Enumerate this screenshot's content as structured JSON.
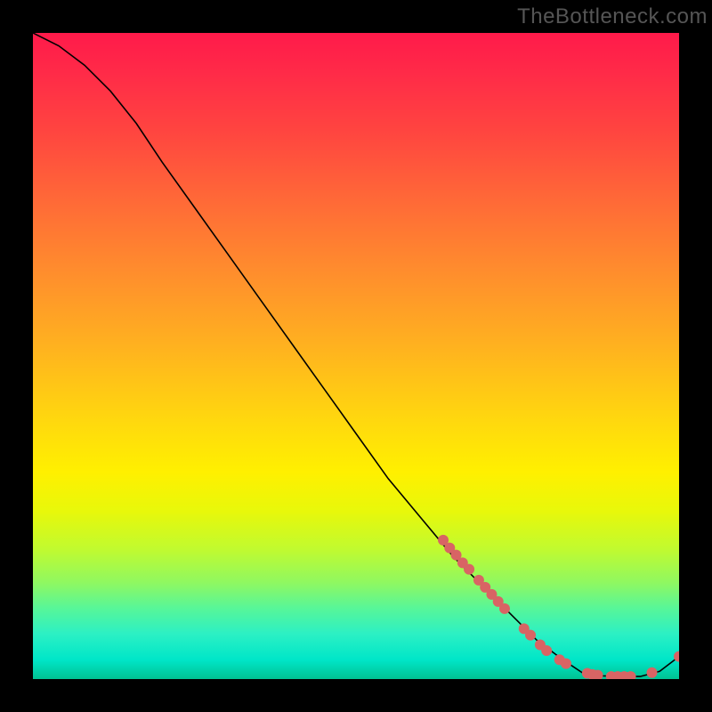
{
  "watermark": "TheBottleneck.com",
  "chart_data": {
    "type": "line",
    "title": "",
    "xlabel": "",
    "ylabel": "",
    "xlim": [
      0,
      100
    ],
    "ylim": [
      0,
      100
    ],
    "curve": {
      "x": [
        0,
        4,
        8,
        12,
        16,
        20,
        25,
        30,
        35,
        40,
        45,
        50,
        55,
        60,
        65,
        70,
        74,
        78,
        82,
        85,
        88,
        91,
        94,
        97,
        100
      ],
      "y": [
        100,
        98,
        95,
        91,
        86,
        80,
        73,
        66,
        59,
        52,
        45,
        38,
        31,
        25,
        19,
        14,
        10,
        6,
        3,
        1,
        0.5,
        0.4,
        0.4,
        1.2,
        3.5
      ]
    },
    "markers": [
      {
        "x": 63.5,
        "y": 21.5
      },
      {
        "x": 64.5,
        "y": 20.3
      },
      {
        "x": 65.5,
        "y": 19.2
      },
      {
        "x": 66.5,
        "y": 18.0
      },
      {
        "x": 67.5,
        "y": 17.0
      },
      {
        "x": 69.0,
        "y": 15.3
      },
      {
        "x": 70.0,
        "y": 14.2
      },
      {
        "x": 71.0,
        "y": 13.1
      },
      {
        "x": 72.0,
        "y": 12.0
      },
      {
        "x": 73.0,
        "y": 10.9
      },
      {
        "x": 76.0,
        "y": 7.8
      },
      {
        "x": 77.0,
        "y": 6.8
      },
      {
        "x": 78.5,
        "y": 5.3
      },
      {
        "x": 79.5,
        "y": 4.4
      },
      {
        "x": 81.5,
        "y": 3.0
      },
      {
        "x": 82.5,
        "y": 2.4
      },
      {
        "x": 85.8,
        "y": 0.9
      },
      {
        "x": 86.6,
        "y": 0.7
      },
      {
        "x": 87.4,
        "y": 0.6
      },
      {
        "x": 89.5,
        "y": 0.4
      },
      {
        "x": 90.5,
        "y": 0.4
      },
      {
        "x": 91.5,
        "y": 0.4
      },
      {
        "x": 92.5,
        "y": 0.4
      },
      {
        "x": 95.8,
        "y": 1.0
      },
      {
        "x": 100,
        "y": 3.5
      }
    ],
    "marker_color": "#d86464",
    "line_color": "#000000"
  }
}
